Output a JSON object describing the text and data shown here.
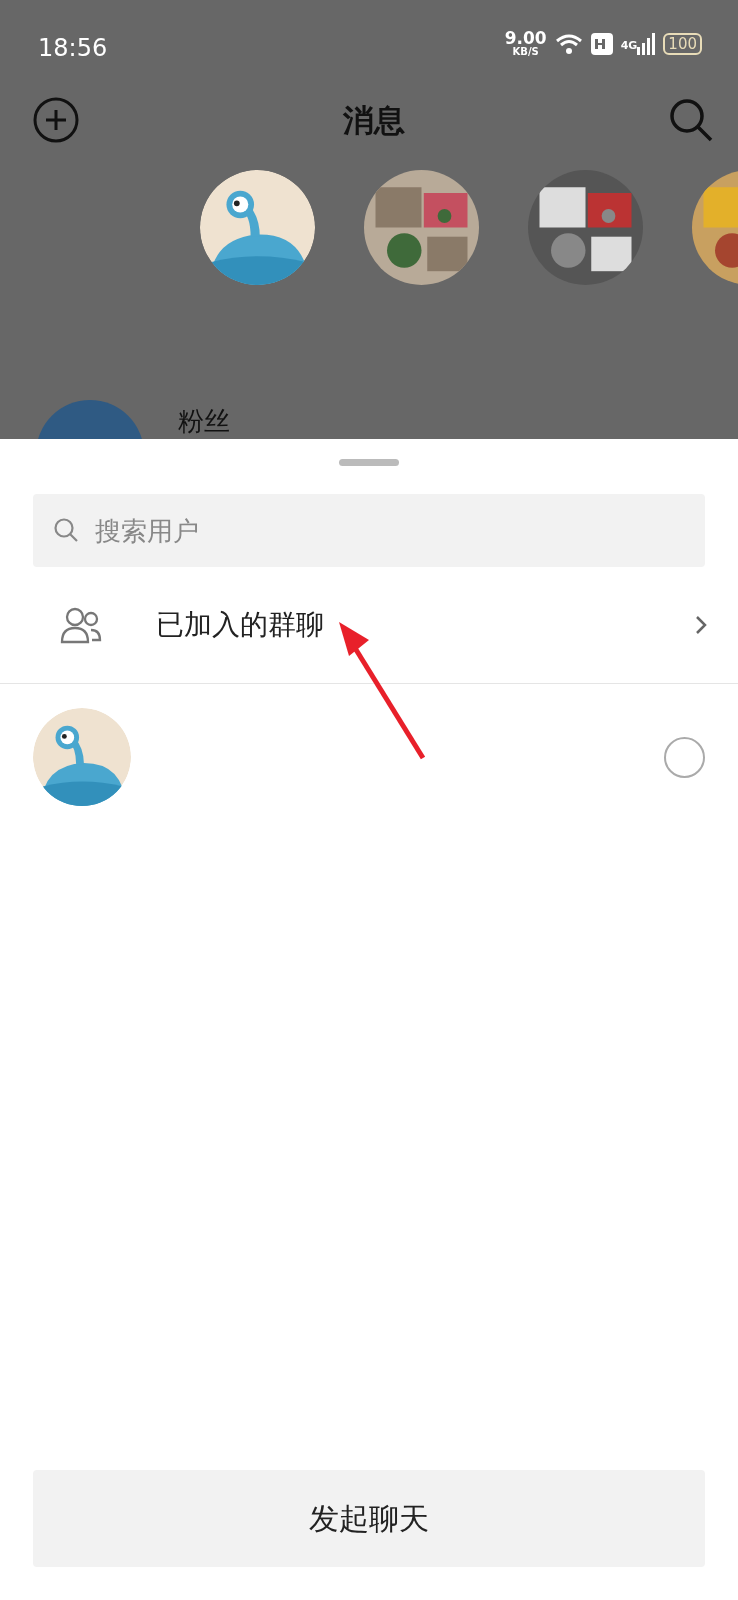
{
  "status_bar": {
    "time": "18:56",
    "net_speed": "9.00",
    "net_unit": "KB/S",
    "network": "4G",
    "battery": "100"
  },
  "header": {
    "title": "消息"
  },
  "stories": [
    {
      "kind": "avatar"
    },
    {
      "kind": "picture"
    },
    {
      "kind": "picture"
    },
    {
      "kind": "picture"
    }
  ],
  "background_list": [
    {
      "title": "粉丝"
    }
  ],
  "sheet": {
    "search": {
      "placeholder": "搜索用户"
    },
    "group_row": {
      "label": "已加入的群聊"
    },
    "contacts": [
      {
        "kind": "avatar",
        "selected": false
      }
    ],
    "start_button": {
      "label": "发起聊天"
    }
  }
}
